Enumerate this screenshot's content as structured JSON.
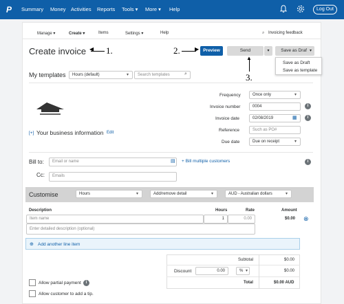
{
  "nav": {
    "logo": "P",
    "items": [
      "Summary",
      "Money",
      "Activities",
      "Reports",
      "Tools ▾",
      "More ▾",
      "Help"
    ],
    "logout": "Log Out"
  },
  "subnav": {
    "items": [
      "Manage ▾",
      "Create ▾",
      "Items",
      "Settings ▾",
      "Help"
    ],
    "feedback": "Invoicing feedback"
  },
  "page": {
    "title": "Create invoice",
    "annotations": [
      "1.",
      "2.",
      "3."
    ]
  },
  "toolbar": {
    "preview": "Preview",
    "send": "Send",
    "save_as_draft": "Save as Draft"
  },
  "draft_menu": {
    "items": [
      "Save as Draft",
      "Save as template"
    ]
  },
  "templates": {
    "label": "My templates",
    "selected": "Hours (default)",
    "search_placeholder": "Search templates"
  },
  "details": {
    "frequency_label": "Frequency",
    "frequency_value": "Once only",
    "invoice_number_label": "Invoice number",
    "invoice_number_value": "0004",
    "invoice_date_label": "Invoice date",
    "invoice_date_value": "02/08/2019",
    "reference_label": "Reference",
    "reference_placeholder": "Such as PO#",
    "due_date_label": "Due date",
    "due_date_value": "Due on receipt"
  },
  "business": {
    "toggle": "[+]",
    "label": "Your business information",
    "edit": "Edit"
  },
  "billing": {
    "bill_to_label": "Bill to:",
    "email_placeholder": "Email or name",
    "multiple_link": "+ Bill multiple customers",
    "cc_label": "Cc:",
    "cc_placeholder": "Emails"
  },
  "customise": {
    "label": "Customise",
    "unit": "Hours",
    "detail": "Add/remove detail",
    "currency": "AUD - Australian dollars"
  },
  "table": {
    "headers": [
      "Description",
      "Hours",
      "Rate",
      "Amount"
    ],
    "row": {
      "item_placeholder": "Item name",
      "hours": "1",
      "rate": "0.00",
      "amount": "$0.00",
      "description_placeholder": "Enter detailed description (optional)"
    },
    "add_line": "Add another line item"
  },
  "totals": {
    "subtotal_label": "Subtotal",
    "subtotal_value": "$0.00",
    "discount_label": "Discount",
    "discount_value": "0.00",
    "discount_unit": "%",
    "discount_amount": "$0.00",
    "total_label": "Total",
    "total_value": "$0.00 AUD"
  },
  "options": {
    "partial_payment": "Allow partial payment",
    "tip": "Allow customer to add a tip."
  },
  "colors": {
    "brand": "#0f5fa8",
    "link": "#0f5fa8"
  }
}
